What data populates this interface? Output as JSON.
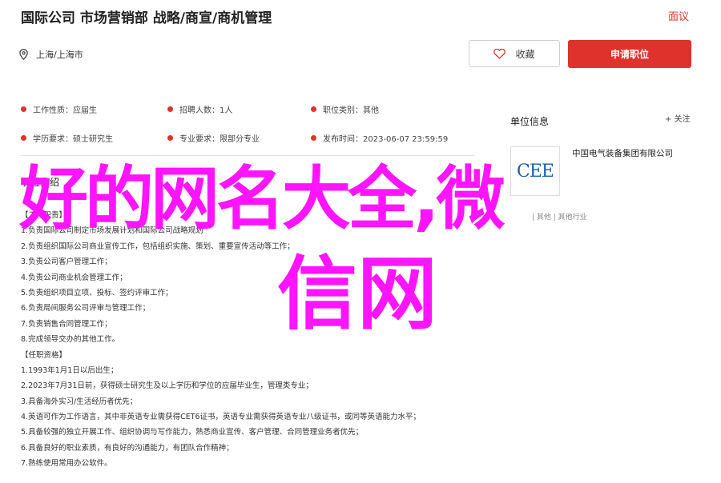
{
  "header": {
    "title": "国际公司 市场营销部 战略/商宣/商机管理",
    "report_label": "面议",
    "location": "上海/上海市",
    "favorite_label": "收藏",
    "apply_label": "申请职位"
  },
  "info": {
    "rows": [
      [
        {
          "label": "工作性质：",
          "value": "应届生"
        },
        {
          "label": "招聘人数：",
          "value": "1人"
        },
        {
          "label": "职位类别：",
          "value": "其他"
        }
      ],
      [
        {
          "label": "学历要求：",
          "value": "硕士研究生"
        },
        {
          "label": "专业要求：",
          "value": "限部分专业"
        },
        {
          "label": "发布时间：",
          "value": "2023-06-07 23:59:59"
        }
      ]
    ]
  },
  "description": {
    "title": "职位介绍",
    "lines": [
      "【工作职责】",
      "1.负责国际公司制定市场发展计划和国际公司战略规划",
      "2.负责组织国际公司商业宣传工作，包括组织实施、策划、重要宣传活动等工作；",
      "3.负责公司客户管理工作；",
      "4.负责公司商业机会管理工作；",
      "5.负责组织项目立项、投标、签约评审工作；",
      "6.负责局间服务公司评审与管理工作；",
      "7.负责销售合同管理工作；",
      "8.完成领导交办的其他工作。",
      "【任职资格】",
      "1.1993年1月1日以后出生；",
      "2.2023年7月31日前，获得硕士研究生及以上学历和学位的应届毕业生，管理类专业；",
      "3.具备海外实习/生活经历者优先；",
      "4.英语可作为工作语言，其中非英语专业需获得CET6证书，英语专业需获得英语专业八级证书，或同等英语能力水平；",
      "5.具备较强的独立开展工作、组织协调与写作能力，熟悉商业宣传、客户管理、合同管理业务者优先；",
      "6.具备良好的职业素质，有良好的沟通能力，有团队合作精神；",
      "7.熟练使用常用办公软件。"
    ]
  },
  "sidebar": {
    "title": "单位信息",
    "report_label": "+ 关注",
    "company_logo_text": "CEE",
    "company_name": "中国电气装备集团有限公司",
    "company_meta": "| 其他 | 其他行业"
  },
  "overlay": {
    "line1": "好的网名大全,微",
    "line2": "信网"
  },
  "colors": {
    "accent": "#e0322c",
    "overlay": "#ff14ff"
  }
}
